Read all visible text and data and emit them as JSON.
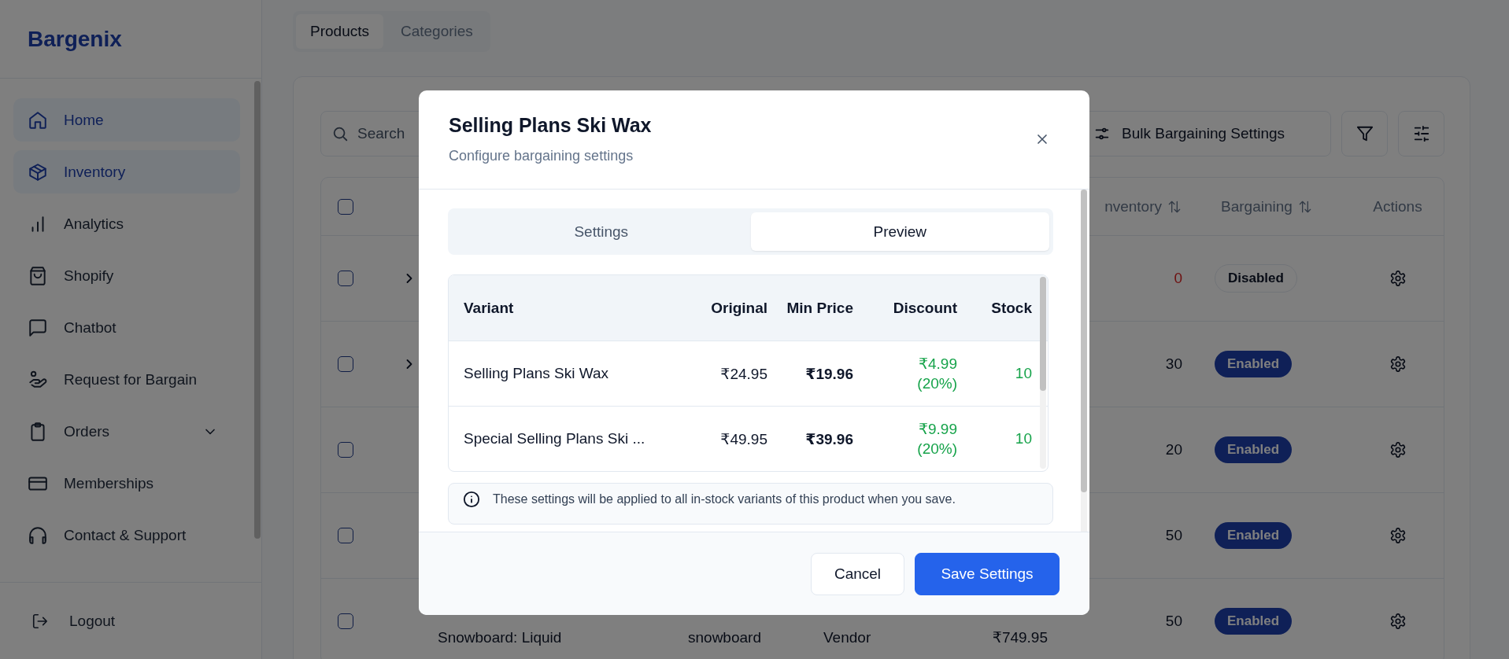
{
  "sidebar": {
    "logo": "Bargenix",
    "items": [
      {
        "label": "Home",
        "kind": "link",
        "selected": true
      },
      {
        "label": "Inventory",
        "kind": "link",
        "selected": true
      },
      {
        "label": "Analytics",
        "kind": "link",
        "selected": false
      },
      {
        "label": "Shopify",
        "kind": "link",
        "selected": false
      },
      {
        "label": "Chatbot",
        "kind": "link",
        "selected": false
      },
      {
        "label": "Request for Bargain",
        "kind": "link",
        "selected": false
      },
      {
        "label": "Orders",
        "kind": "group",
        "selected": false,
        "expanded": false
      },
      {
        "label": "Memberships",
        "kind": "link",
        "selected": false
      },
      {
        "label": "Contact & Support",
        "kind": "link",
        "selected": false
      }
    ],
    "logout": "Logout"
  },
  "page_tabs": [
    {
      "label": "Products",
      "selected": true
    },
    {
      "label": "Categories",
      "selected": false
    }
  ],
  "toolbar": {
    "search": {
      "placeholder": "Search"
    },
    "bulk_button": "Bulk Bargaining Settings"
  },
  "products_table": {
    "header": {
      "checked": false,
      "inventory": "nventory",
      "bargaining": "Bargaining",
      "actions": "Actions"
    },
    "rows": [
      {
        "checked": false,
        "expandable": true,
        "inventory": "0",
        "out_of_stock": true,
        "bargaining": "Disabled",
        "bargaining_enabled": false
      },
      {
        "checked": false,
        "expandable": true,
        "inventory": "30",
        "out_of_stock": false,
        "bargaining": "Enabled",
        "bargaining_enabled": true
      },
      {
        "checked": false,
        "expandable": false,
        "inventory": "20",
        "out_of_stock": false,
        "bargaining": "Enabled",
        "bargaining_enabled": true
      },
      {
        "checked": false,
        "expandable": false,
        "inventory": "50",
        "out_of_stock": false,
        "bargaining": "Enabled",
        "bargaining_enabled": true
      },
      {
        "checked": false,
        "expandable": false,
        "product": "Snowboard: Liquid",
        "type": "snowboard",
        "vendor": "Vendor",
        "price": "₹749.95",
        "inventory": "50",
        "out_of_stock": false,
        "bargaining": "Enabled",
        "bargaining_enabled": true
      }
    ]
  },
  "modal": {
    "title": "Selling Plans Ski Wax",
    "subtitle": "Configure bargaining settings",
    "tabs": [
      {
        "label": "Settings",
        "selected": false
      },
      {
        "label": "Preview",
        "selected": true
      }
    ],
    "preview_table": {
      "columns": [
        "Variant",
        "Original",
        "Min Price",
        "Discount",
        "Stock"
      ],
      "rows": [
        {
          "variant": "Selling Plans Ski Wax",
          "original": "₹24.95",
          "min_price": "₹19.96",
          "discount": "₹4.99 (20%)",
          "stock": "10"
        },
        {
          "variant": "Special Selling Plans Ski ...",
          "original": "₹49.95",
          "min_price": "₹39.96",
          "discount": "₹9.99 (20%)",
          "stock": "10"
        }
      ]
    },
    "note": "These settings will be applied to all in-stock variants of this product when you save.",
    "buttons": [
      {
        "label": "Cancel",
        "kind": "secondary"
      },
      {
        "label": "Save Settings",
        "kind": "primary"
      }
    ]
  }
}
